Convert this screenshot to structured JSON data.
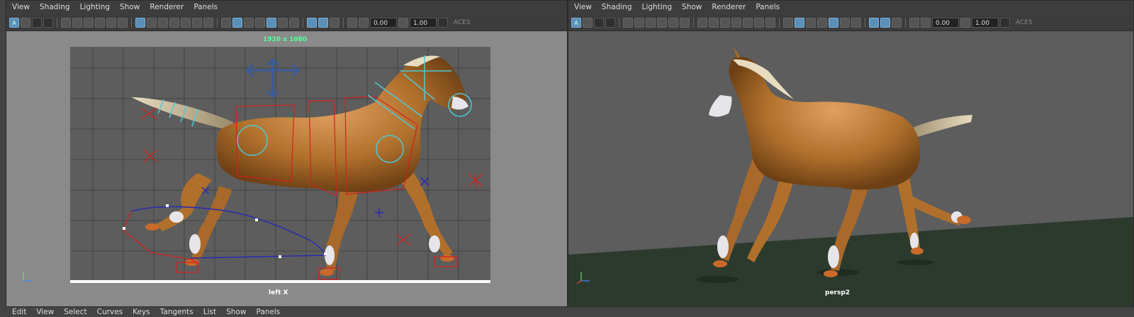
{
  "left_viewport": {
    "menu": [
      "View",
      "Shading",
      "Lighting",
      "Show",
      "Renderer",
      "Panels"
    ],
    "camera_label": "left X",
    "resolution_label": "1920 x 1080",
    "field_a": "0.00",
    "field_b": "1.00",
    "color_mode": "ACES"
  },
  "right_viewport": {
    "menu": [
      "View",
      "Shading",
      "Lighting",
      "Show",
      "Renderer",
      "Panels"
    ],
    "camera_label": "persp2",
    "field_a": "0.00",
    "field_b": "1.00",
    "color_mode": "ACES"
  },
  "graph_editor_menu": [
    "Edit",
    "View",
    "Select",
    "Curves",
    "Keys",
    "Tangents",
    "List",
    "Show",
    "Panels"
  ],
  "colors": {
    "accent": "#5a8fb8",
    "horse_body": "#b5722c",
    "rig_red": "#d42020",
    "rig_blue": "#2a2ab0",
    "rig_cyan": "#4fc8d8",
    "ground": "#2c3a2e"
  }
}
